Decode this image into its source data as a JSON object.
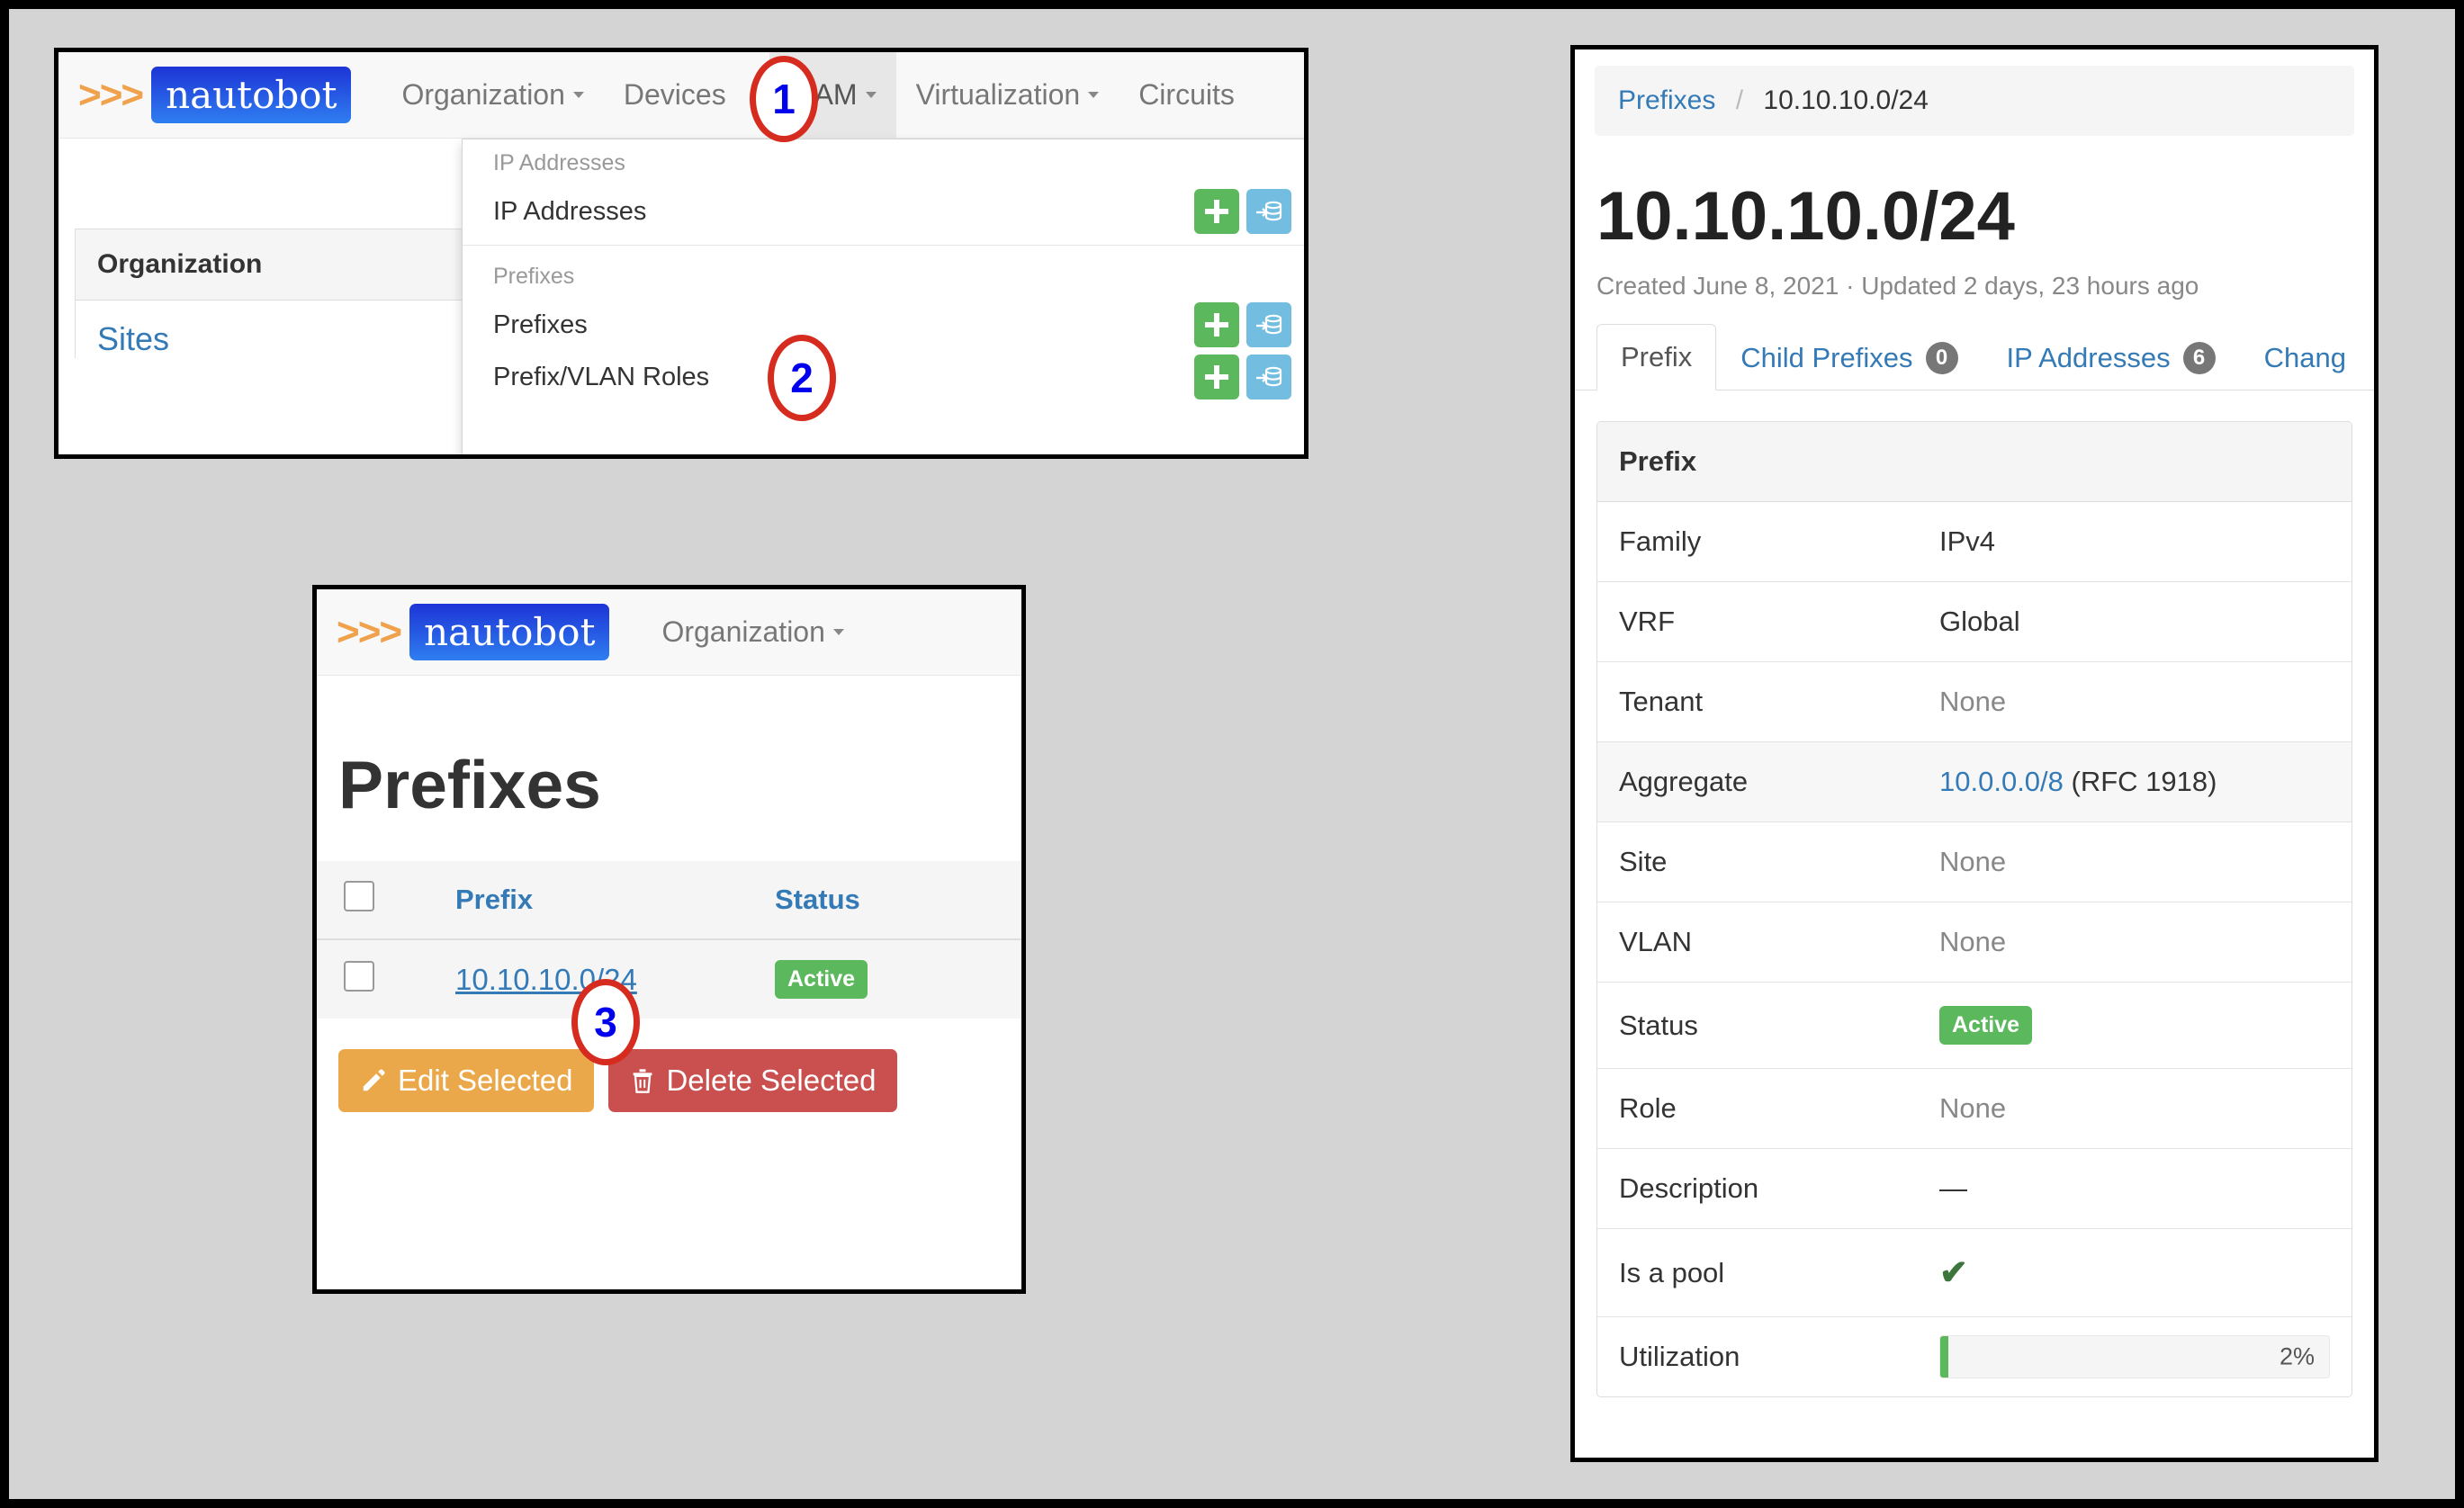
{
  "brand": {
    "chevrons": "》》",
    "name": "nautobot"
  },
  "panel_nav": {
    "nav_items": [
      {
        "label": "Organization",
        "caret": true,
        "open": false
      },
      {
        "label": "Devices",
        "caret": true,
        "open": false
      },
      {
        "label": "IPAM",
        "caret": true,
        "open": true
      },
      {
        "label": "Virtualization",
        "caret": true,
        "open": false
      },
      {
        "label": "Circuits",
        "caret": true,
        "open": false
      }
    ],
    "dropdown": {
      "groups": [
        {
          "header": "IP Addresses",
          "items": [
            {
              "label": "IP Addresses",
              "add_icon": "plus-icon",
              "import_icon": "database-import-icon"
            }
          ]
        },
        {
          "header": "Prefixes",
          "items": [
            {
              "label": "Prefixes",
              "add_icon": "plus-icon",
              "import_icon": "database-import-icon"
            },
            {
              "label": "Prefix/VLAN Roles",
              "add_icon": "plus-icon",
              "import_icon": "database-import-icon"
            }
          ]
        }
      ]
    },
    "org_card": {
      "header": "Organization",
      "link": "Sites"
    }
  },
  "panel_list": {
    "nav_items": [
      {
        "label": "Organization",
        "caret": true
      }
    ],
    "page_title": "Prefixes",
    "table": {
      "columns": [
        "",
        "Prefix",
        "Status"
      ],
      "rows": [
        {
          "checkbox": false,
          "prefix": "10.10.10.0/24",
          "status": "Active"
        }
      ]
    },
    "buttons": [
      {
        "label": "Edit Selected",
        "icon": "pencil-icon",
        "style": "warning"
      },
      {
        "label": "Delete Selected",
        "icon": "trash-icon",
        "style": "danger"
      }
    ]
  },
  "panel_detail": {
    "breadcrumb": {
      "parent": "Prefixes",
      "separator": "/",
      "current": "10.10.10.0/24"
    },
    "title": "10.10.10.0/24",
    "meta": "Created June 8, 2021 · Updated 2 days, 23 hours ago",
    "tabs": [
      {
        "label": "Prefix",
        "count": null,
        "active": true
      },
      {
        "label": "Child Prefixes",
        "count": "0",
        "active": false
      },
      {
        "label": "IP Addresses",
        "count": "6",
        "active": false
      },
      {
        "label": "Chang",
        "count": null,
        "active": false
      }
    ],
    "card_header": "Prefix",
    "rows": [
      {
        "key": "Family",
        "value": "IPv4",
        "type": "text"
      },
      {
        "key": "VRF",
        "value": "Global",
        "type": "text"
      },
      {
        "key": "Tenant",
        "value": "None",
        "type": "muted"
      },
      {
        "key": "Aggregate",
        "value": "10.0.0.0/8",
        "suffix": " (RFC 1918)",
        "type": "link"
      },
      {
        "key": "Site",
        "value": "None",
        "type": "muted"
      },
      {
        "key": "VLAN",
        "value": "None",
        "type": "muted"
      },
      {
        "key": "Status",
        "value": "Active",
        "type": "badge"
      },
      {
        "key": "Role",
        "value": "None",
        "type": "muted"
      },
      {
        "key": "Description",
        "value": "—",
        "type": "text"
      },
      {
        "key": "Is a pool",
        "value": "✔",
        "type": "check"
      },
      {
        "key": "Utilization",
        "value": "2%",
        "type": "progress",
        "percent": 2
      }
    ]
  },
  "callouts": [
    {
      "number": "1"
    },
    {
      "number": "2"
    },
    {
      "number": "3"
    }
  ],
  "colors": {
    "accent_blue": "#337ab7",
    "brand_orange": "#f0a14b",
    "success_green": "#5cb85c",
    "warning_orange": "#eaa84a",
    "danger_red": "#ca5050",
    "callout_red": "#d62b1f",
    "callout_number": "#0000ee"
  }
}
